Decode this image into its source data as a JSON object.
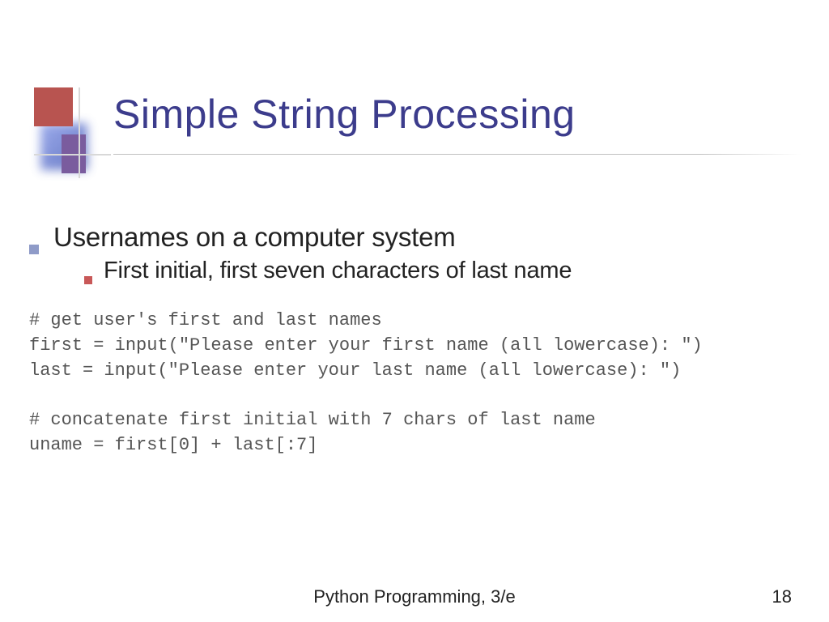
{
  "slide": {
    "title": "Simple String Processing",
    "bullet1": "Usernames on a computer system",
    "sub1": "First initial, first seven characters of last name",
    "code": "# get user's first and last names\nfirst = input(\"Please enter your first name (all lowercase): \")\nlast = input(\"Please enter your last name (all lowercase): \")\n\n# concatenate first initial with 7 chars of last name\nuname = first[0] + last[:7]",
    "footer": "Python Programming, 3/e",
    "page": "18"
  }
}
